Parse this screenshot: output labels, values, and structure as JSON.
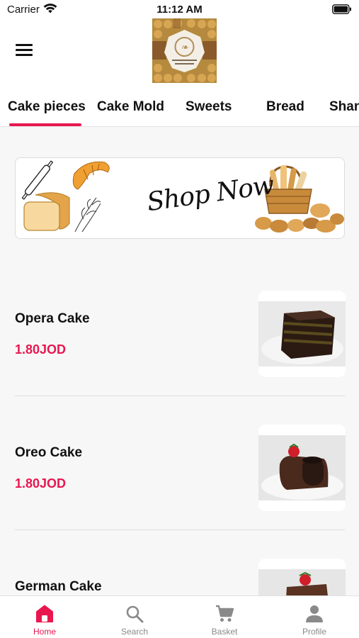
{
  "status_bar": {
    "carrier": "Carrier",
    "time": "11:12 AM"
  },
  "header": {
    "logo_icon": "store-logo"
  },
  "tabs": [
    {
      "label": "Cake pieces",
      "active": true
    },
    {
      "label": "Cake Mold",
      "active": false
    },
    {
      "label": "Sweets",
      "active": false
    },
    {
      "label": "Bread",
      "active": false
    },
    {
      "label": "Shan",
      "active": false
    }
  ],
  "banner": {
    "text": "Shop Now"
  },
  "products": [
    {
      "name": "Opera Cake",
      "price": "1.80JOD"
    },
    {
      "name": "Oreo Cake",
      "price": "1.80JOD"
    },
    {
      "name": "German Cake",
      "price": ""
    }
  ],
  "bottom_nav": [
    {
      "label": "Home",
      "icon": "home-icon",
      "active": true
    },
    {
      "label": "Search",
      "icon": "search-icon",
      "active": false
    },
    {
      "label": "Basket",
      "icon": "cart-icon",
      "active": false
    },
    {
      "label": "Profile",
      "icon": "profile-icon",
      "active": false
    }
  ],
  "colors": {
    "accent": "#e8174f",
    "inactive": "#8a8a8a"
  }
}
